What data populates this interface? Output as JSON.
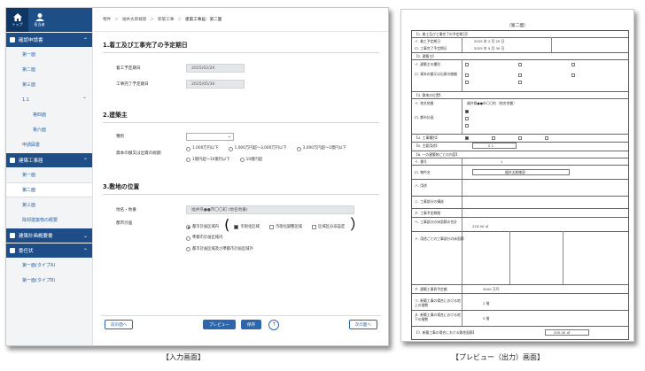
{
  "nav": {
    "home_label": "トップ",
    "user_label": "担当者",
    "sections": [
      {
        "label": "確認申請書"
      },
      {
        "label": "建築工事届"
      },
      {
        "label": "建築計画概要書"
      },
      {
        "label": "委任状"
      }
    ],
    "items_application": [
      "第一面",
      "第二面",
      "第三面",
      "1.1",
      "第四面",
      "第六面",
      "申請図書"
    ],
    "items_construction": [
      "第一面",
      "第二面",
      "第三面",
      "除却建築物の概要"
    ],
    "items_attorney": [
      "第一面(タイプA)",
      "第一面(タイプB)"
    ]
  },
  "breadcrumb": [
    "物件",
    "福井太郎様邸",
    "新築工事",
    "建築工事届：第二面"
  ],
  "sections": {
    "s1_title": "1.着工及び工事完了の予定期日",
    "start_label": "着工予定期日",
    "start_value": "2025/02/20",
    "end_label": "工事完了予定期日",
    "end_value": "2025/05/30",
    "s2_title": "2.建築主",
    "type_label": "種別",
    "capital_label": "資本の額又は出資の総額",
    "capital_options": [
      "1,000万円以下",
      "1,000万円超〜3,000万円以下",
      "3,000万円超〜1億円以下",
      "1億円超〜10億円以下",
      "10億円超"
    ],
    "s3_title": "3.敷地の位置",
    "address_label": "地名・地番",
    "address_value": "福井県●●市〇〇町 (地名地番)",
    "plan_label": "都市計画",
    "plan_options": [
      "都市計画区域内",
      "市街化区域",
      "市街化調整区域",
      "区域区分非設定",
      "準都市計画区域内",
      "都市計画区域及び準都市計画区域外"
    ],
    "plan_close": "）"
  },
  "footer": {
    "prev": "前の面へ",
    "preview": "プレビュー",
    "save": "保存",
    "up": "↑",
    "next": "次の面へ"
  },
  "captions": {
    "left": "【入力画面】",
    "right": "【プレビュー（出力）画面】"
  },
  "preview": {
    "title": "（第二面）",
    "s1": "【1. 着工及び工事完了の予定期日】",
    "r1a": "イ. 着工予定期日",
    "r1a_v": "2025 年 2 月 20 日",
    "r1b": "ロ. 工事完了予定期日",
    "r1b_v": "2025 年 5 月 30 日",
    "s2": "【2. 建築主】",
    "r2a": "イ. 建築主の種別",
    "r2b": "ロ. 資本の額又は出資の総額",
    "s3": "【3. 敷地の位置】",
    "r3a": "イ. 地名地番",
    "r3a_v": "福井県●●市〇〇町（地名地番）",
    "r3b": "ロ. 都市計画",
    "s4": "【4. 工事種別】",
    "s5": "【5. 主要用途】",
    "r5_v": "0 1",
    "s6": "【6. 一の建築物ごとの内容】",
    "r6a": "イ. 番号",
    "r6a_v": "1",
    "r6b": "ロ. 物件名",
    "r6b_v": "福井太郎様邸",
    "r6c": "ハ. 用途",
    "r6d": "ニ. 工事部分の構造",
    "r6e": "ホ. 工事予定期間",
    "r6f": "ヘ. 工事部分の床面積の合計",
    "r6f_v": "220.00 ㎡",
    "r6g": "ト. 用途ごとの工事部分の床面積",
    "r6h": "チ. 建築工事費予定額",
    "r6h_v": "4500 万円",
    "r6i": "リ. 新築工事の場合における地上の階数",
    "r6i_v": "2 階",
    "r6j": "ヌ. 新築工事の場合における地下の階数",
    "r6j_v": "0 階",
    "s7": "【7. 新築工事の場合における敷地面積】",
    "r7_v": "200.00 ㎡"
  }
}
